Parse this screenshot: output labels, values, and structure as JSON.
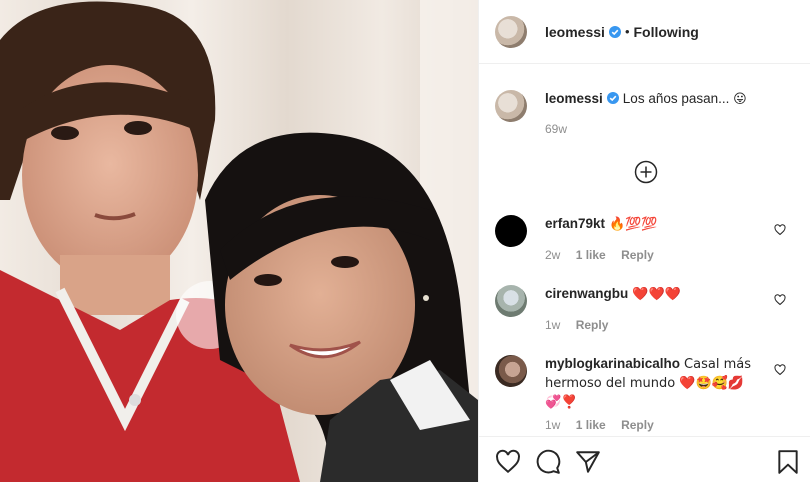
{
  "post": {
    "username": "leomessi",
    "follow_status": "Following",
    "caption": "Los años pasan...",
    "caption_emoji": "😛",
    "age": "69w"
  },
  "comments": [
    {
      "user": "erfan79kt",
      "text": "🔥💯💯",
      "age": "2w",
      "likes": "1 like",
      "reply": "Reply"
    },
    {
      "user": "cirenwangbu",
      "text": "❤️❤️❤️",
      "age": "1w",
      "likes": "",
      "reply": "Reply"
    },
    {
      "user": "myblogkarinabicalho",
      "text": "Casal más hermoso del mundo ❤️🤩🥰💋💞❣️",
      "age": "1w",
      "likes": "1 like",
      "reply": "Reply"
    }
  ],
  "icons": {
    "verified": "verified-badge-icon",
    "load_more": "plus-circle-icon",
    "like": "heart-icon",
    "comment": "comment-icon",
    "share": "share-icon",
    "save": "bookmark-icon"
  },
  "colors": {
    "verified_blue": "#3897f0",
    "text": "#262626",
    "muted": "#8e8e8e",
    "border": "#efefef"
  }
}
